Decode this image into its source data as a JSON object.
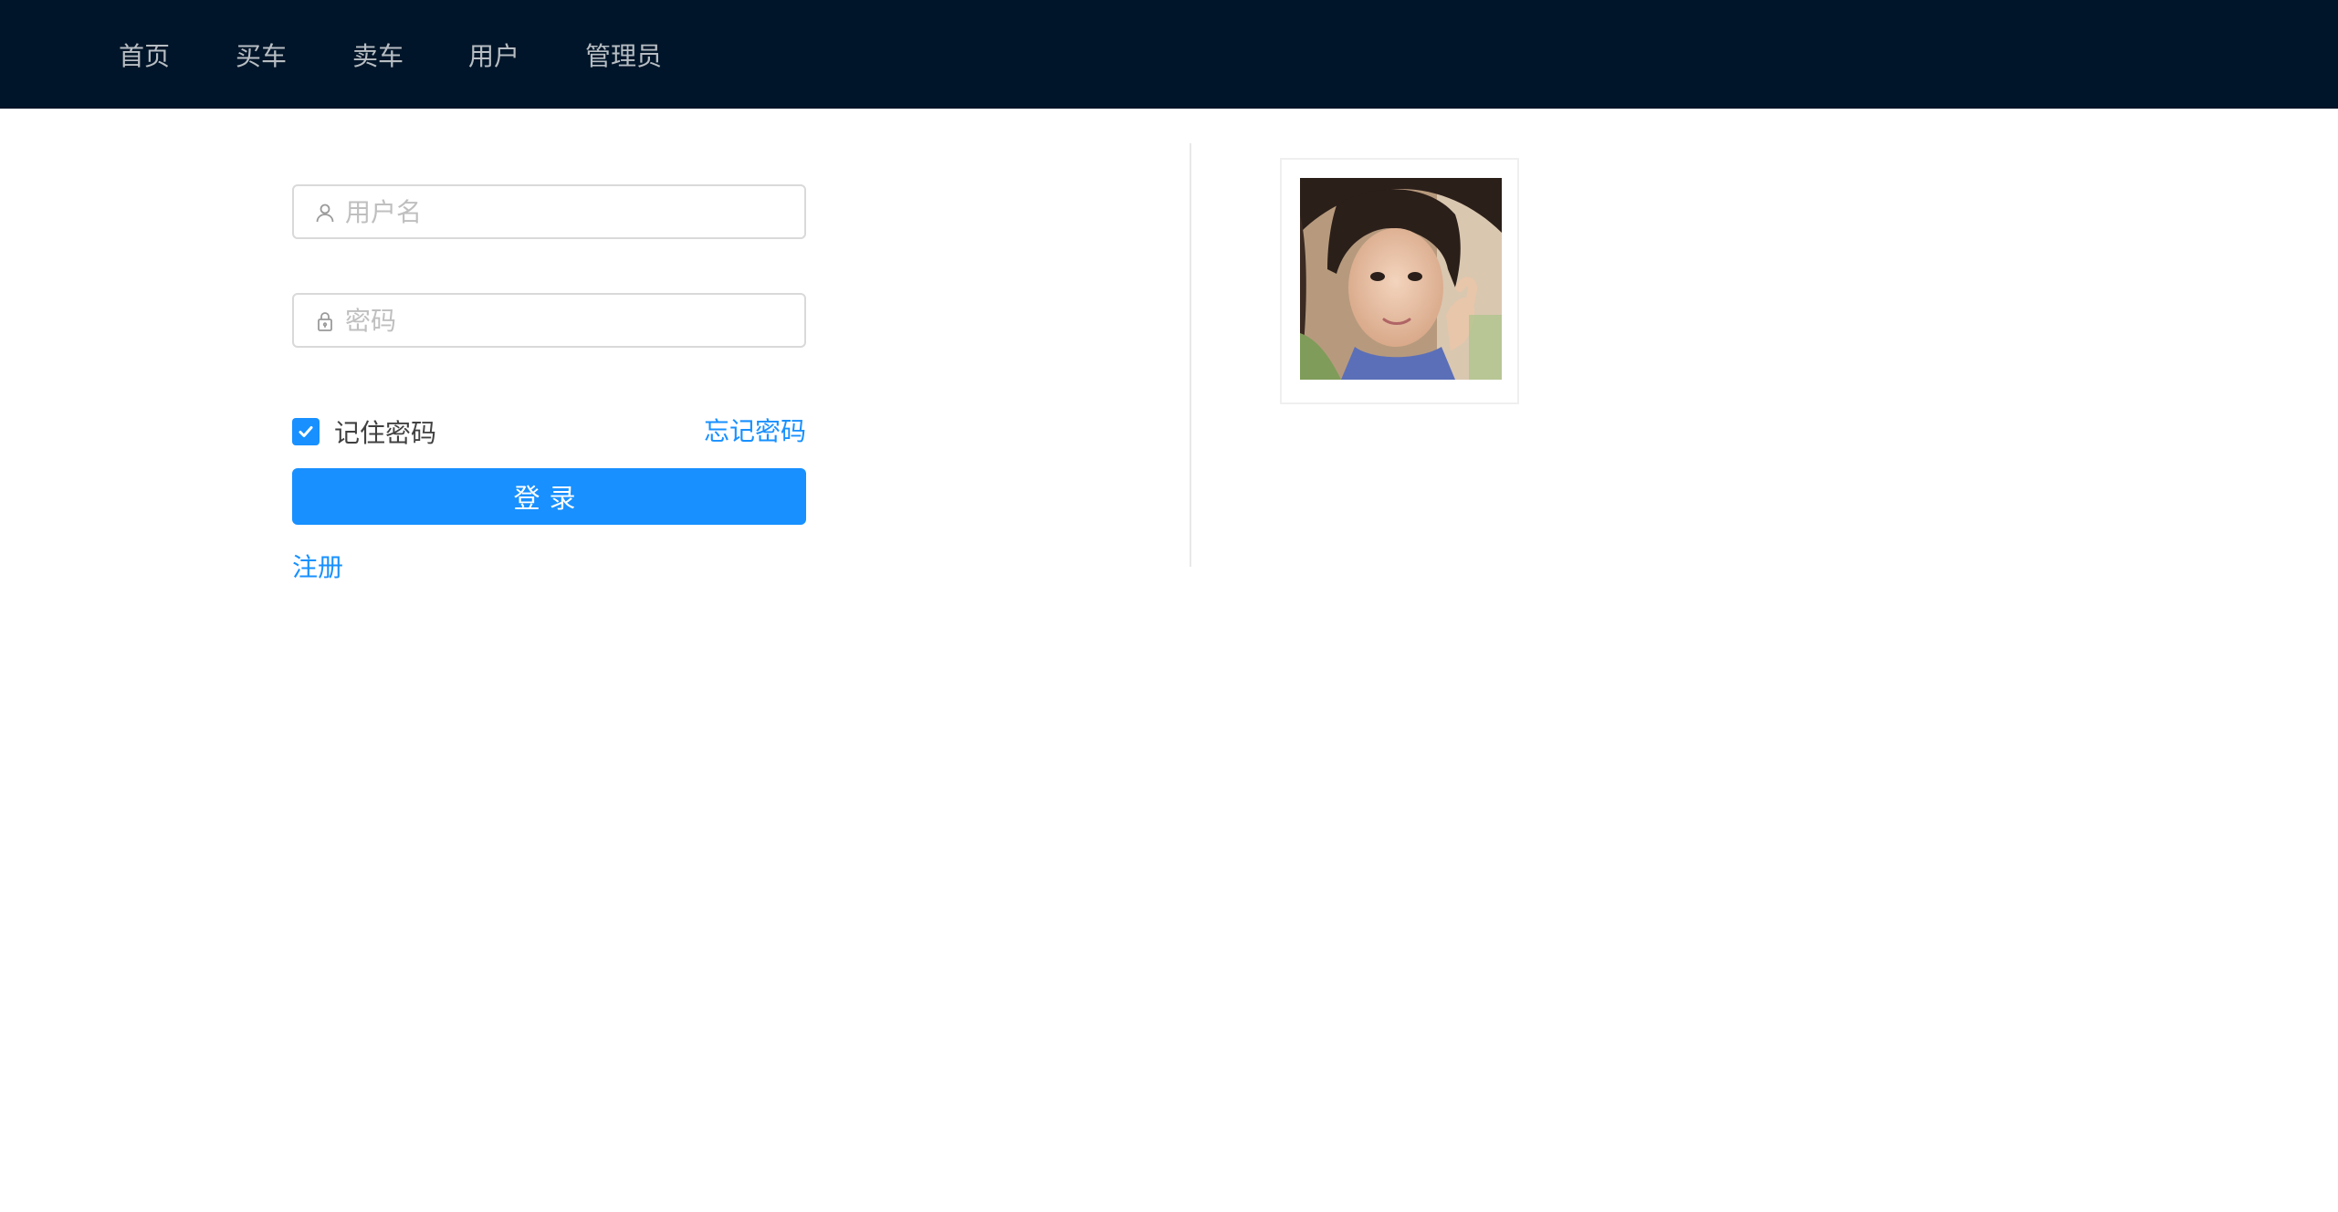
{
  "nav": {
    "items": [
      {
        "label": "首页"
      },
      {
        "label": "买车"
      },
      {
        "label": "卖车"
      },
      {
        "label": "用户"
      },
      {
        "label": "管理员"
      }
    ]
  },
  "login": {
    "username_placeholder": "用户名",
    "password_placeholder": "密码",
    "username_value": "",
    "password_value": "",
    "remember_label": "记住密码",
    "remember_checked": true,
    "forgot_label": "忘记密码",
    "submit_label": "登录",
    "register_label": "注册"
  },
  "icons": {
    "username": "user-icon",
    "password": "lock-icon",
    "checkbox": "check-icon"
  },
  "colors": {
    "header_bg": "#001529",
    "primary": "#1890ff",
    "nav_text": "rgba(255,255,255,0.72)"
  }
}
